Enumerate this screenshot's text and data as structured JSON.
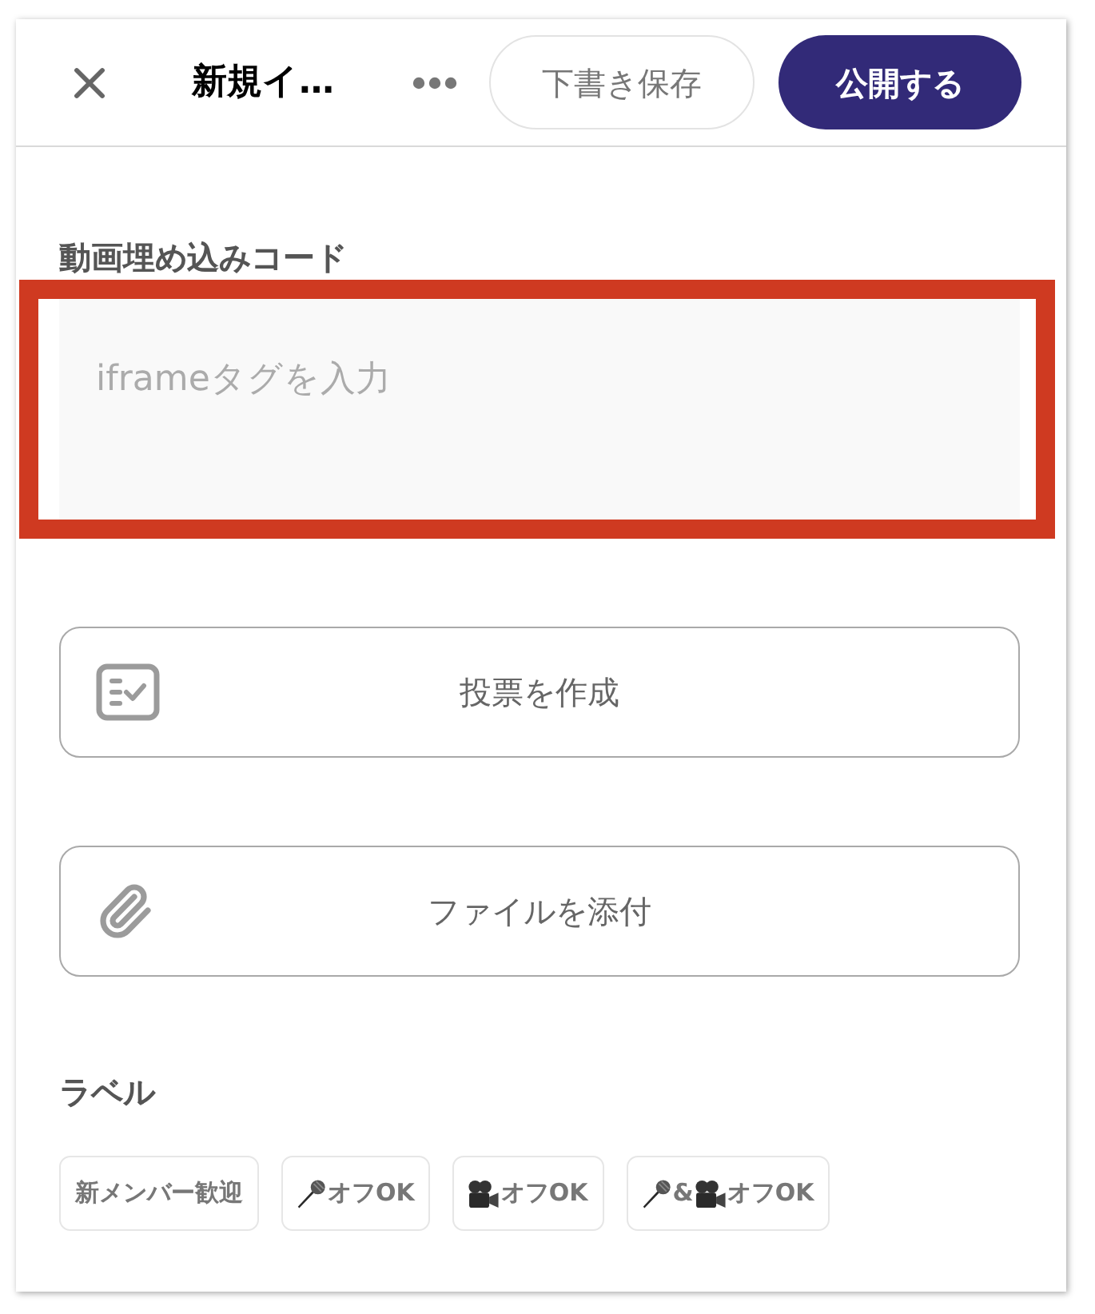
{
  "header": {
    "title": "新規イ…",
    "draft_button": "下書き保存",
    "publish_button": "公開する"
  },
  "embed": {
    "label": "動画埋め込みコード",
    "placeholder": "iframeタグを入力"
  },
  "actions": [
    {
      "kind": "poll",
      "label": "投票を作成"
    },
    {
      "kind": "attachment",
      "label": "ファイルを添付"
    }
  ],
  "labels": {
    "title": "ラベル",
    "chips": [
      {
        "kind": "text",
        "text": "新メンバー歓迎"
      },
      {
        "kind": "mic",
        "text": "オフOK"
      },
      {
        "kind": "camera",
        "text": "オフOK"
      },
      {
        "kind": "mic_camera",
        "joiner": "&",
        "text": "オフOK"
      }
    ]
  }
}
